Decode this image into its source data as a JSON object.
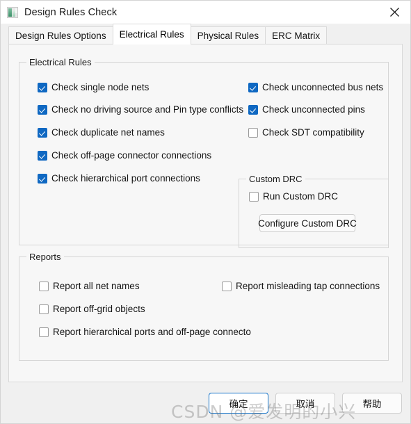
{
  "window": {
    "title": "Design Rules Check",
    "icon": "app-icon",
    "close_icon": "close-icon"
  },
  "tabs": [
    {
      "label": "Design Rules Options",
      "active": false
    },
    {
      "label": "Electrical Rules",
      "active": true
    },
    {
      "label": "Physical Rules",
      "active": false
    },
    {
      "label": "ERC Matrix",
      "active": false
    }
  ],
  "electrical_rules": {
    "title": "Electrical Rules",
    "left_column": [
      {
        "label": "Check single node nets",
        "checked": true
      },
      {
        "label": "Check no driving source and Pin type conflicts",
        "checked": true
      },
      {
        "label": "Check duplicate net names",
        "checked": true
      },
      {
        "label": "Check off-page connector connections",
        "checked": true
      },
      {
        "label": "Check hierarchical port connections",
        "checked": true
      }
    ],
    "right_column": [
      {
        "label": "Check unconnected bus nets",
        "checked": true
      },
      {
        "label": "Check unconnected pins",
        "checked": true
      },
      {
        "label": "Check SDT compatibility",
        "checked": false
      }
    ]
  },
  "custom_drc": {
    "title": "Custom DRC",
    "run_checkbox": {
      "label": "Run Custom DRC",
      "checked": false
    },
    "configure_button": "Configure Custom DRC"
  },
  "reports": {
    "title": "Reports",
    "left_column": [
      {
        "label": "Report all net names",
        "checked": false
      },
      {
        "label": "Report off-grid objects",
        "checked": false
      },
      {
        "label": "Report hierarchical ports and off-page connecto",
        "checked": false
      }
    ],
    "right_column": [
      {
        "label": "Report misleading tap connections",
        "checked": false
      }
    ]
  },
  "footer": {
    "ok": "确定",
    "cancel": "取消",
    "help": "帮助"
  },
  "watermark": "CSDN @爱发明的小兴",
  "colors": {
    "accent": "#0f68c2",
    "default_button_border": "#1573c8",
    "dialog_background": "#f0f0f0",
    "panel_background": "#f7f7f7"
  }
}
